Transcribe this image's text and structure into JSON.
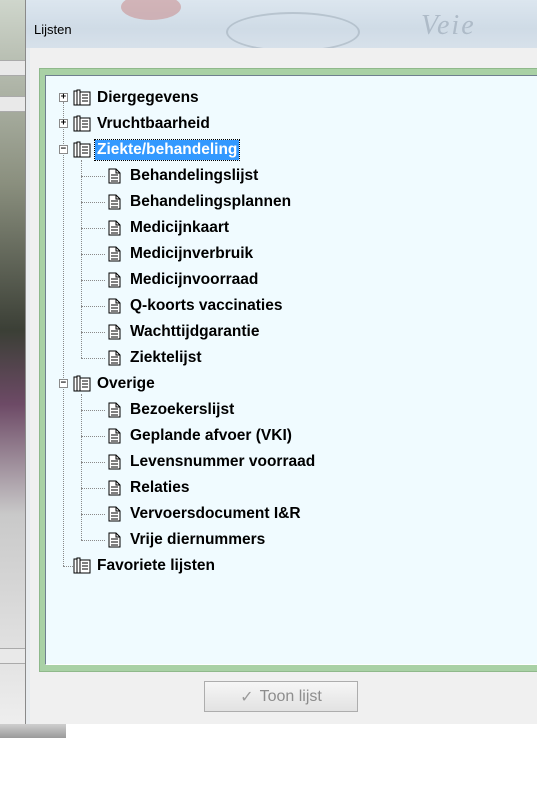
{
  "window": {
    "title": "Lijsten"
  },
  "tree": {
    "groups": [
      {
        "label": "Diergegevens",
        "expanded": false,
        "selected": false,
        "children": []
      },
      {
        "label": "Vruchtbaarheid",
        "expanded": false,
        "selected": false,
        "children": []
      },
      {
        "label": "Ziekte/behandeling",
        "expanded": true,
        "selected": true,
        "children": [
          "Behandelingslijst",
          "Behandelingsplannen",
          "Medicijnkaart",
          "Medicijnverbruik",
          "Medicijnvoorraad",
          "Q-koorts vaccinaties",
          "Wachttijdgarantie",
          "Ziektelijst"
        ]
      },
      {
        "label": "Overige",
        "expanded": true,
        "selected": false,
        "children": [
          "Bezoekerslijst",
          "Geplande afvoer (VKI)",
          "Levensnummer voorraad",
          "Relaties",
          "Vervoersdocument I&R",
          "Vrije diernummers"
        ]
      },
      {
        "label": "Favoriete lijsten",
        "expanded": null,
        "selected": false,
        "children": []
      }
    ]
  },
  "buttons": {
    "show_list": "Toon lijst",
    "show_list_enabled": false
  },
  "icons": {
    "group": "book-icon",
    "leaf": "document-icon",
    "button": "checkmark-icon"
  },
  "colors": {
    "selection": "#3399ff",
    "tree_bg": "#f0fbff",
    "group_border": "#a9d1a5"
  }
}
